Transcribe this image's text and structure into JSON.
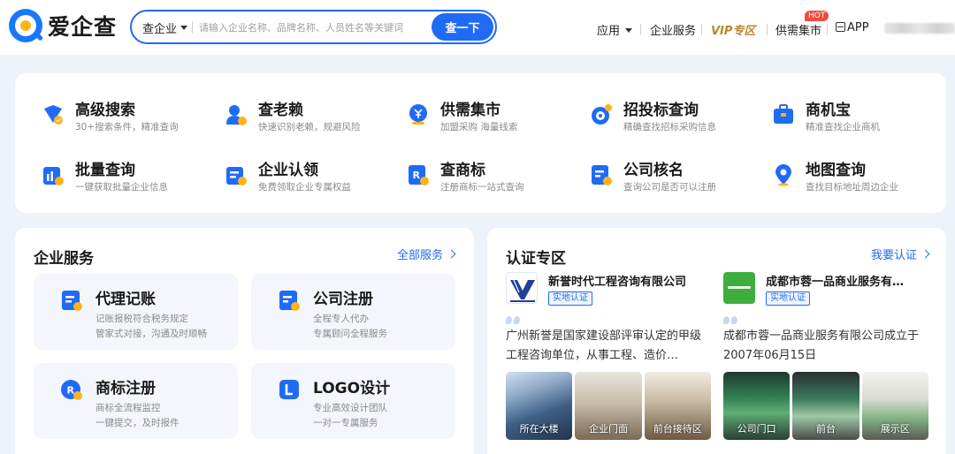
{
  "header": {
    "logo_text": "爱企查",
    "search_type": "查企业",
    "search_placeholder": "请输入企业名称、品牌名称、人员姓名等关键词",
    "search_button": "查一下",
    "nav": {
      "apps": "应用",
      "enterprise_services": "企业服务",
      "vip": "VIP专区",
      "supply_market": "供需集市",
      "hot_badge": "HOT",
      "app": "APP"
    }
  },
  "features": [
    {
      "title": "高级搜索",
      "desc": "30+搜索条件，精准查询",
      "icon": "advanced-search-icon"
    },
    {
      "title": "查老赖",
      "desc": "快速识别老赖，规避风险",
      "icon": "defaulter-icon"
    },
    {
      "title": "供需集市",
      "desc": "加盟采购 海量线索",
      "icon": "supply-market-icon"
    },
    {
      "title": "招投标查询",
      "desc": "精确查找招标采购信息",
      "icon": "bidding-icon"
    },
    {
      "title": "商机宝",
      "desc": "精准查找企业商机",
      "icon": "business-opportunity-icon"
    },
    {
      "title": "批量查询",
      "desc": "一键获取批量企业信息",
      "icon": "batch-query-icon"
    },
    {
      "title": "企业认领",
      "desc": "免费领取企业专属权益",
      "icon": "enterprise-claim-icon"
    },
    {
      "title": "查商标",
      "desc": "注册商标一站式查询",
      "icon": "trademark-icon"
    },
    {
      "title": "公司核名",
      "desc": "查询公司是否可以注册",
      "icon": "company-name-check-icon"
    },
    {
      "title": "地图查询",
      "desc": "查找目标地址周边企业",
      "icon": "map-pin-icon"
    }
  ],
  "services": {
    "title": "企业服务",
    "all_link": "全部服务",
    "cards": [
      {
        "title": "代理记账",
        "line1": "记账报税符合税务规定",
        "line2": "管家式对接，沟通及时顺畅",
        "icon": "bookkeeping-icon"
      },
      {
        "title": "公司注册",
        "line1": "全程专人代办",
        "line2": "专属顾问全程服务",
        "icon": "company-registration-icon"
      },
      {
        "title": "商标注册",
        "line1": "商标全流程监控",
        "line2": "一键提交，及时报件",
        "icon": "trademark-registration-icon"
      },
      {
        "title": "LOGO设计",
        "line1": "专业高效设计团队",
        "line2": "一对一专属服务",
        "icon": "logo-design-icon"
      }
    ]
  },
  "certification": {
    "title": "认证专区",
    "link": "我要认证",
    "companies": [
      {
        "name": "新誉时代工程咨询有限公司",
        "badge": "实地认证",
        "desc": "广州新誉是国家建设部评审认定的甲级工程咨询单位，从事工程、造价…",
        "photos": [
          "所在大楼",
          "企业门面",
          "前台接待区"
        ]
      },
      {
        "name": "成都市蓉一品商业服务有…",
        "badge": "实地认证",
        "desc": "成都市蓉一品商业服务有限公司成立于2007年06月15日",
        "photos": [
          "公司门口",
          "前台",
          "展示区"
        ]
      }
    ]
  },
  "colors": {
    "primary": "#1f6bf5",
    "vip_gold": "#b8872c",
    "hot_red": "#f04a3a",
    "page_bg": "#eef3fb"
  }
}
